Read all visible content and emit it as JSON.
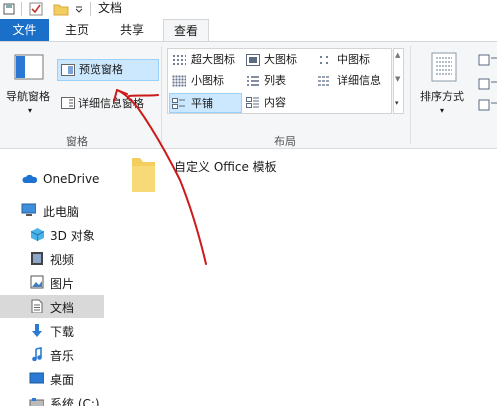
{
  "window": {
    "title": "文档"
  },
  "tabs": {
    "file": "文件",
    "home": "主页",
    "share": "共享",
    "view": "查看"
  },
  "ribbon": {
    "panes": {
      "nav_pane": "导航窗格",
      "preview_pane": "预览窗格",
      "details_pane": "详细信息窗格",
      "group_label": "窗格"
    },
    "layout": {
      "extra_large": "超大图标",
      "large": "大图标",
      "medium": "中图标",
      "small": "小图标",
      "list": "列表",
      "details": "详细信息",
      "tiles": "平铺",
      "content": "内容",
      "group_label": "布局"
    },
    "sort": {
      "label": "排序方式"
    }
  },
  "navigation": [
    {
      "label": "OneDrive",
      "icon": "cloud-icon"
    },
    {
      "label": "此电脑",
      "icon": "computer-icon"
    },
    {
      "label": "3D 对象",
      "icon": "cube-icon"
    },
    {
      "label": "视频",
      "icon": "video-icon"
    },
    {
      "label": "图片",
      "icon": "picture-icon"
    },
    {
      "label": "文档",
      "icon": "document-icon"
    },
    {
      "label": "下载",
      "icon": "download-icon"
    },
    {
      "label": "音乐",
      "icon": "music-icon"
    },
    {
      "label": "桌面",
      "icon": "desktop-icon"
    },
    {
      "label": "系统 (C:)",
      "icon": "drive-icon"
    }
  ],
  "content": {
    "items": [
      {
        "name": "自定义 Office 模板"
      }
    ]
  },
  "colors": {
    "accent": "#1a6fc9",
    "selected": "#cce8ff",
    "annotation": "#cc1a1a",
    "folder": "#f3cd5e"
  }
}
